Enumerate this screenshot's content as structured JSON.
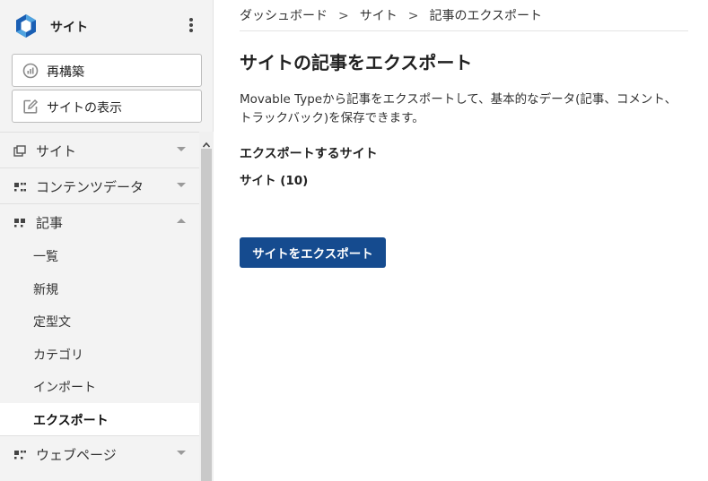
{
  "sidebar": {
    "site_name": "サイト",
    "buttons": {
      "rebuild": "再構築",
      "view_site": "サイトの表示"
    },
    "menu": [
      {
        "label": "サイト",
        "icon": "site-stack-icon",
        "expanded": false
      },
      {
        "label": "コンテンツデータ",
        "icon": "content-data-icon",
        "expanded": false
      },
      {
        "label": "記事",
        "icon": "entry-icon",
        "expanded": true
      },
      {
        "label": "ウェブページ",
        "icon": "webpage-icon",
        "expanded": false
      }
    ],
    "entries_submenu": [
      "一覧",
      "新規",
      "定型文",
      "カテゴリ",
      "インポート",
      "エクスポート"
    ],
    "active_submenu": "エクスポート"
  },
  "breadcrumb": {
    "items": [
      "ダッシュボード",
      "サイト",
      "記事のエクスポート"
    ],
    "separator": ">"
  },
  "main": {
    "title": "サイトの記事をエクスポート",
    "description": "Movable Typeから記事をエクスポートして、基本的なデータ(記事、コメント、トラックバック)を保存できます。",
    "section_heading": "エクスポートするサイト",
    "selected_site": "サイト (10)",
    "export_button": "サイトをエクスポート"
  },
  "colors": {
    "accent": "#154b8f",
    "sidebar_bg": "#f3f3f3",
    "logo_blue": "#1a5fb4",
    "logo_light": "#4fa3e0"
  }
}
